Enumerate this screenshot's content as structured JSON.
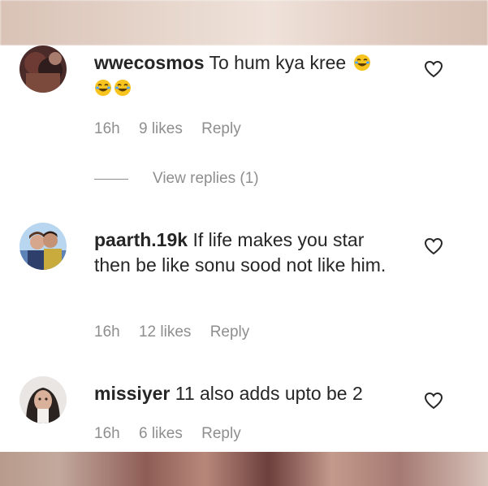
{
  "comments": [
    {
      "username": "wwecosmos",
      "text": "To hum kya kree",
      "emoji": "😂😂😂",
      "time": "16h",
      "likes": "9 likes",
      "reply": "Reply",
      "view_replies": "View replies (1)",
      "avatar": "avatar-wwecosmos"
    },
    {
      "username": "paarth.19k",
      "text": "If life makes you star then be like sonu sood not like him.",
      "time": "16h",
      "likes": "12 likes",
      "reply": "Reply",
      "avatar": "avatar-paarth"
    },
    {
      "username": "missiyer",
      "text": "11 also adds upto be 2",
      "time": "16h",
      "likes": "6 likes",
      "reply": "Reply",
      "avatar": "avatar-missiyer"
    }
  ],
  "icons": {
    "like": "heart-outline-icon",
    "emoji": "joy-emoji-icon"
  },
  "colors": {
    "text": "#262626",
    "secondary": "#8e8e8e",
    "background": "#ffffff",
    "emoji": "#f7c31f"
  }
}
